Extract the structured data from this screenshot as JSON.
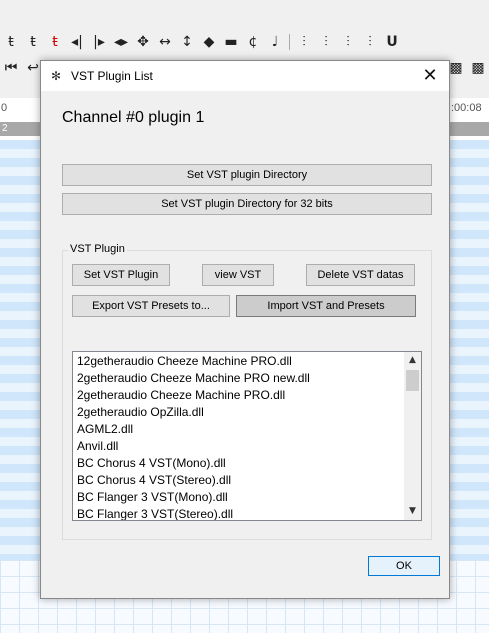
{
  "background": {
    "toolbar_icons_row1": [
      "ŧ",
      "ŧ",
      "ŧ",
      "◂|",
      "|▸",
      "◂▸",
      "✥",
      "↔",
      "↕",
      "◆",
      "▬",
      "¢",
      "♩",
      "⫶",
      "⫶",
      "⫶",
      "⫶",
      "U"
    ],
    "toolbar_icons_row2": [
      "⏮",
      "↩"
    ],
    "toolbar_icons_row2_right": [
      "▩",
      "▩"
    ],
    "ruler_left": "0",
    "ruler_left2": "2",
    "ruler_right": ":00:08"
  },
  "dialog": {
    "title": "VST Plugin List",
    "close_glyph": "✕",
    "icon_glyph": "✻",
    "heading": "Channel #0 plugin 1",
    "set_dir_button": "Set VST plugin Directory",
    "set_dir32_button": "Set VST plugin Directory for 32 bits",
    "group_label": "VST Plugin",
    "set_plugin_button": "Set VST Plugin",
    "view_button": "view VST",
    "delete_button": "Delete VST datas",
    "export_button": "Export VST Presets to...",
    "import_button": "Import VST and Presets",
    "plugins": [
      "12getheraudio Cheeze Machine PRO.dll",
      "2getheraudio Cheeze Machine PRO new.dll",
      "2getheraudio Cheeze Machine PRO.dll",
      "2getheraudio OpZilla.dll",
      "AGML2.dll",
      "Anvil.dll",
      "BC Chorus 4 VST(Mono).dll",
      "BC Chorus 4 VST(Stereo).dll",
      "BC Flanger 3 VST(Mono).dll",
      "BC Flanger 3 VST(Stereo).dll"
    ],
    "scroll_up_glyph": "▲",
    "scroll_down_glyph": "▼",
    "ok_button": "OK"
  }
}
